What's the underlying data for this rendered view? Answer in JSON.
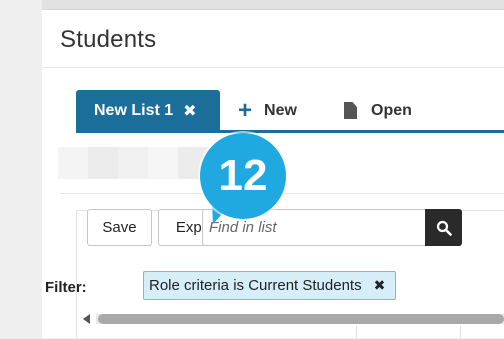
{
  "page": {
    "title": "Students"
  },
  "tabs": {
    "active_label": "New List 1",
    "close_symbol": "✖",
    "new_label": "New",
    "open_label": "Open"
  },
  "toolbar": {
    "save_label": "Save",
    "export_label": "Export",
    "find_placeholder": "Find in list"
  },
  "filter": {
    "label": "Filter:",
    "chip_text": "Role criteria is Current Students",
    "remove_symbol": "✖"
  },
  "callout": {
    "number": "12"
  },
  "icons": [
    "plus-icon",
    "document-icon",
    "search-icon",
    "close-icon",
    "scroll-left-icon"
  ],
  "colors": {
    "tab_active": "#1b6e99",
    "callout": "#1fa9e0",
    "chip_bg": "#d6eef8",
    "search_button": "#2a2a2a"
  }
}
